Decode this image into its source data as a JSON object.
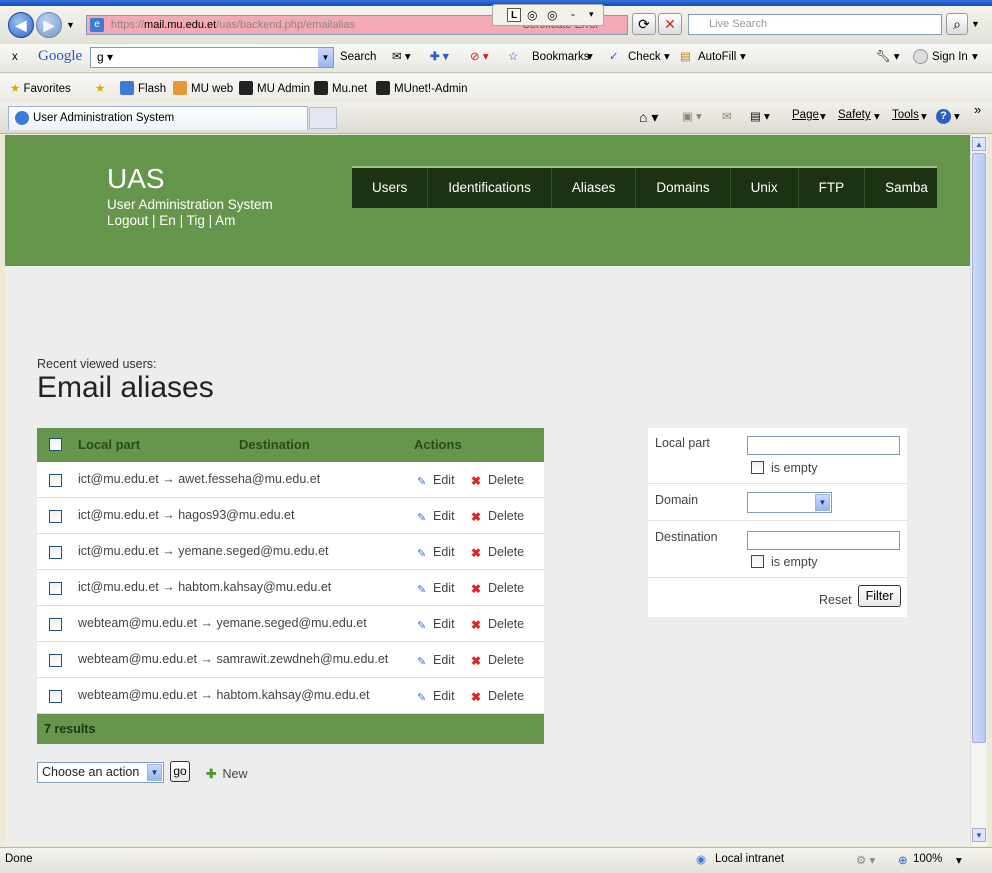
{
  "browser": {
    "address_host": "mail.mu.edu.et",
    "address_path": "/uas/backend.php/emailalias",
    "address_scheme": "https://",
    "cert_error": "Certificate Error",
    "search_placeholder": "Live Search"
  },
  "google_toolbar": {
    "close": "x",
    "logo": "Google",
    "search_input": "g ▾",
    "search_label": "Search",
    "bookmarks": "Bookmarks",
    "check": "Check",
    "autofill": "AutoFill",
    "sign_in": "Sign In"
  },
  "favorites": {
    "label": "Favorites",
    "items": [
      "Flash",
      "MU web",
      "MU Admin",
      "Mu.net",
      "MUnet!-Admin"
    ]
  },
  "tab": {
    "label": "User Administration System"
  },
  "commandbar": {
    "page": "Page",
    "safety": "Safety",
    "tools": "Tools"
  },
  "app": {
    "title": "UAS",
    "subtitle": "User Administration System",
    "links": "Logout | En | Tig | Am",
    "nav": [
      "Users",
      "Identifications",
      "Aliases",
      "Domains",
      "Unix",
      "FTP",
      "Samba"
    ]
  },
  "content": {
    "recent_label": "Recent viewed users:",
    "heading": "Email aliases",
    "columns": {
      "local_part": "Local part",
      "destination": "Destination",
      "actions": "Actions"
    },
    "rows": [
      {
        "alias": "ict@mu.edu.et → awet.fesseha@mu.edu.et"
      },
      {
        "alias": "ict@mu.edu.et → hagos93@mu.edu.et"
      },
      {
        "alias": "ict@mu.edu.et → yemane.seged@mu.edu.et"
      },
      {
        "alias": "ict@mu.edu.et → habtom.kahsay@mu.edu.et"
      },
      {
        "alias": "webteam@mu.edu.et → yemane.seged@mu.edu.et"
      },
      {
        "alias": "webteam@mu.edu.et → samrawit.zewdneh@mu.edu.et"
      },
      {
        "alias": "webteam@mu.edu.et → habtom.kahsay@mu.edu.et"
      }
    ],
    "edit_label": "Edit",
    "delete_label": "Delete",
    "results": "7 results",
    "action_select": "Choose an action",
    "go": "go",
    "new": "New"
  },
  "filter": {
    "local_part": "Local part",
    "is_empty": "is empty",
    "domain": "Domain",
    "destination": "Destination",
    "reset": "Reset",
    "filter": "Filter"
  },
  "status": {
    "left": "Done",
    "zone": "Local intranet",
    "zoom": "100%"
  }
}
